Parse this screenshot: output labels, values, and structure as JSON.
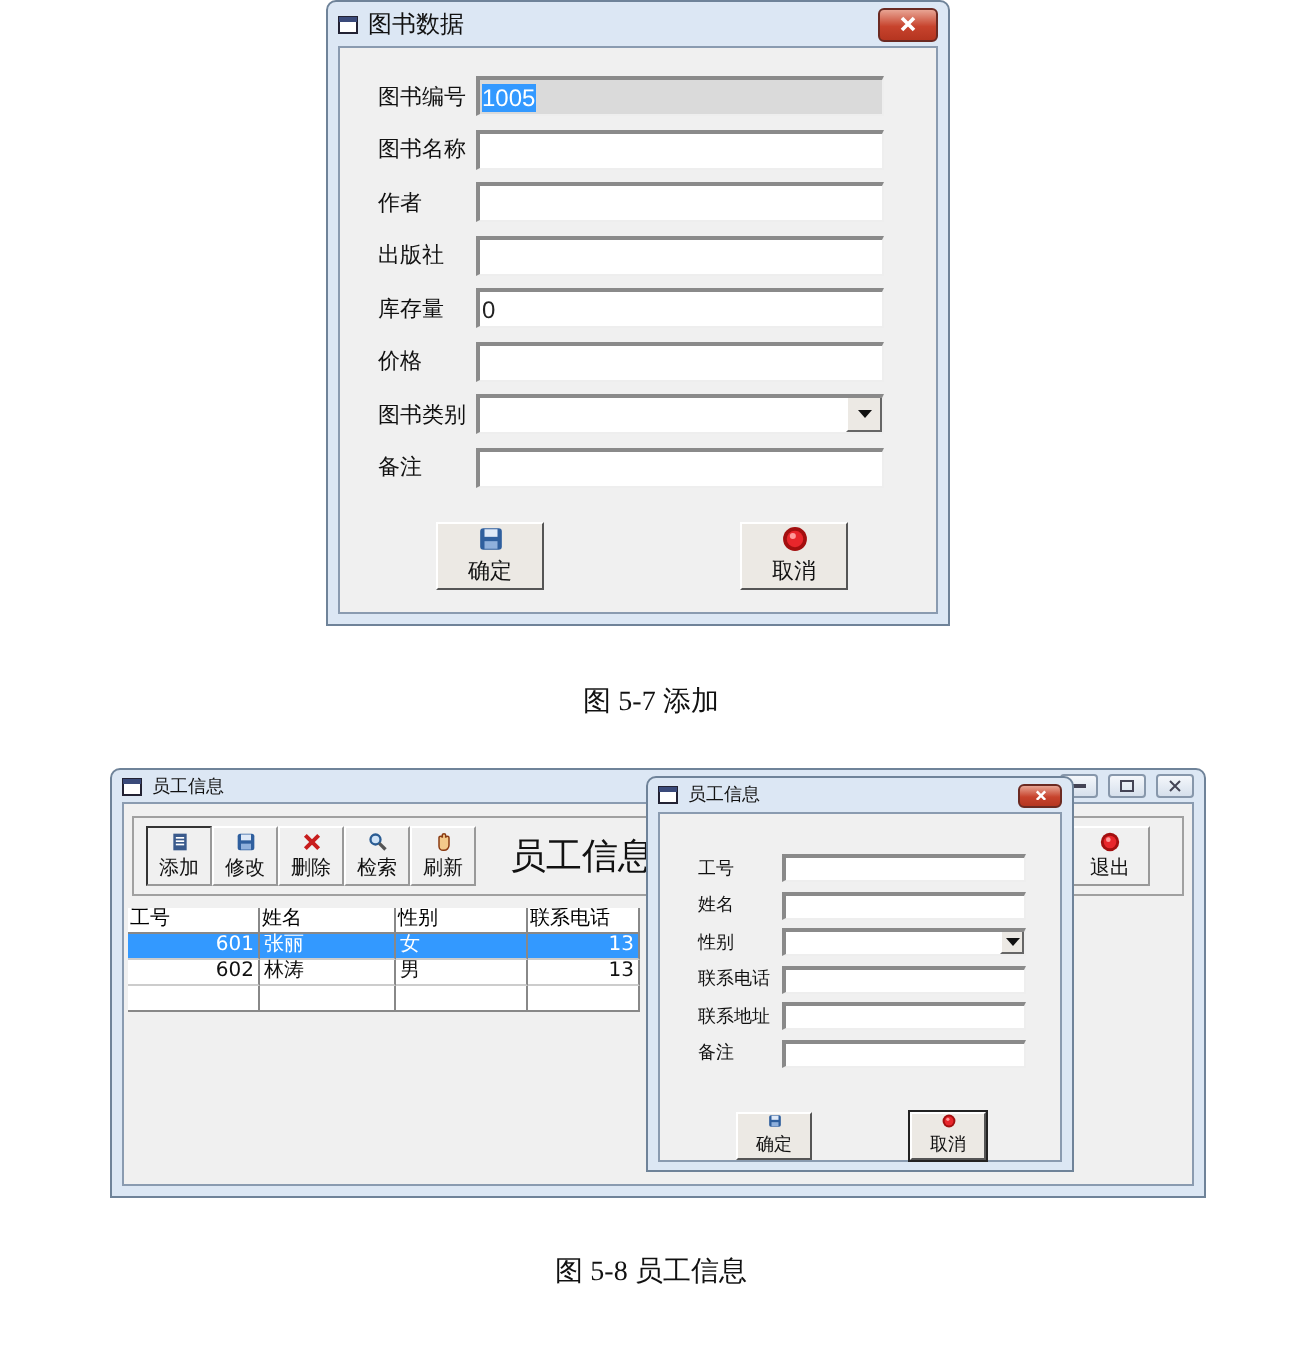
{
  "book_dialog": {
    "title": "图书数据",
    "fields": [
      {
        "label": "图书编号",
        "kind": "text",
        "value": "1005",
        "disabled": true,
        "text_selected": true
      },
      {
        "label": "图书名称",
        "kind": "text",
        "disabled": false
      },
      {
        "label": "作者",
        "kind": "text",
        "disabled": false
      },
      {
        "label": "出版社",
        "kind": "text",
        "disabled": false
      },
      {
        "label": "库存量",
        "kind": "text",
        "value": "0",
        "disabled": false,
        "text_selected": false
      },
      {
        "label": "价格",
        "kind": "text",
        "disabled": false
      },
      {
        "label": "图书类别",
        "kind": "combo",
        "disabled": false
      },
      {
        "label": "备注",
        "kind": "text",
        "disabled": false
      }
    ],
    "buttons": [
      {
        "label": "确定",
        "kind": "save",
        "focused": false
      },
      {
        "label": "取消",
        "kind": "stop",
        "focused": false
      }
    ]
  },
  "caption_1": "图 5-7 添加",
  "staff_window": {
    "title": "员工信息",
    "toolbar": [
      {
        "label": "添加",
        "kind": "add",
        "selected": true
      },
      {
        "label": "修改",
        "kind": "save",
        "selected": false
      },
      {
        "label": "删除",
        "kind": "delete",
        "selected": false
      },
      {
        "label": "检索",
        "kind": "search",
        "selected": false
      },
      {
        "label": "刷新",
        "kind": "refresh",
        "selected": false
      }
    ],
    "heading": "员工信息",
    "exit_button": {
      "label": "退出",
      "kind": "stop"
    },
    "table": {
      "columns": [
        "工号",
        "姓名",
        "性别",
        "联系电话"
      ],
      "rows": [
        {
          "cells": [
            "601",
            "张丽",
            "女",
            "13"
          ],
          "selected": true
        },
        {
          "cells": [
            "602",
            "林涛",
            "男",
            "13"
          ],
          "selected": false
        }
      ]
    }
  },
  "staff_dialog": {
    "title": "员工信息",
    "fields": [
      {
        "label": "工号",
        "kind": "text",
        "disabled": false
      },
      {
        "label": "姓名",
        "kind": "text",
        "disabled": false
      },
      {
        "label": "性别",
        "kind": "combo",
        "disabled": false
      },
      {
        "label": "联系电话",
        "kind": "text",
        "disabled": false
      },
      {
        "label": "联系地址",
        "kind": "text",
        "disabled": false
      },
      {
        "label": "备注",
        "kind": "text",
        "disabled": false
      }
    ],
    "buttons": [
      {
        "label": "确定",
        "kind": "save",
        "focused": false
      },
      {
        "label": "取消",
        "kind": "stop",
        "focused": true
      }
    ]
  },
  "caption_2": "图 5-8 员工信息"
}
